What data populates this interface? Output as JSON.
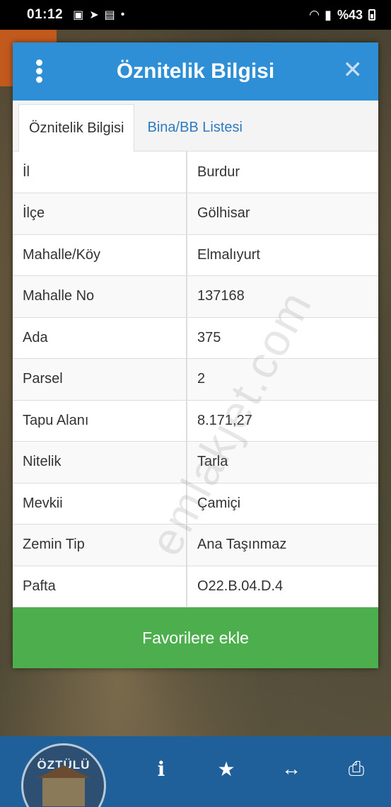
{
  "status_bar": {
    "time": "01:12",
    "battery": "%43"
  },
  "modal": {
    "title": "Öznitelik Bilgisi",
    "tabs": [
      {
        "label": "Öznitelik Bilgisi",
        "active": true
      },
      {
        "label": "Bina/BB Listesi",
        "active": false
      }
    ],
    "rows": [
      {
        "key": "İl",
        "value": "Burdur"
      },
      {
        "key": "İlçe",
        "value": "Gölhisar"
      },
      {
        "key": "Mahalle/Köy",
        "value": "Elmalıyurt"
      },
      {
        "key": "Mahalle No",
        "value": "137168"
      },
      {
        "key": "Ada",
        "value": "375"
      },
      {
        "key": "Parsel",
        "value": "2"
      },
      {
        "key": "Tapu Alanı",
        "value": "8.171,27"
      },
      {
        "key": "Nitelik",
        "value": "Tarla"
      },
      {
        "key": "Mevkii",
        "value": "Çamiçi"
      },
      {
        "key": "Zemin Tip",
        "value": "Ana Taşınmaz"
      },
      {
        "key": "Pafta",
        "value": "O22.B.04.D.4"
      }
    ],
    "favorite_button": "Favorilere ekle"
  },
  "watermark": "emlakjet.com",
  "toolbar": {
    "logo_text": "ÖZTÜLÜ",
    "icons": [
      "info-icon",
      "star-icon",
      "arrows-horizontal-icon",
      "print-icon"
    ]
  },
  "colors": {
    "header": "#2e8ed6",
    "button": "#4cae4c",
    "toolbar": "#1f5f9a"
  }
}
